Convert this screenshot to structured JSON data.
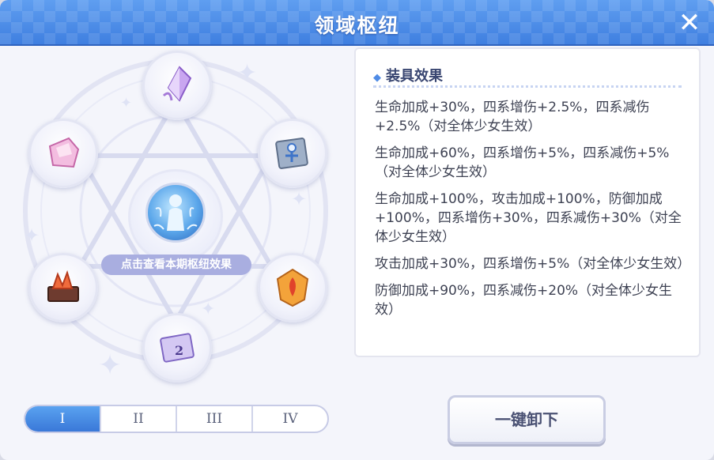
{
  "window": {
    "title": "领域枢纽",
    "close_icon": "close-icon"
  },
  "sigil": {
    "center_label": "点击查看本期枢纽效果",
    "center_icon": "domain-hub-icon",
    "slots": [
      {
        "icon": "crystal-shard-icon"
      },
      {
        "icon": "pink-crystal-icon"
      },
      {
        "icon": "blueprint-icon"
      },
      {
        "icon": "flame-box-icon"
      },
      {
        "icon": "fire-emblem-icon"
      },
      {
        "icon": "card-2-icon",
        "label": "2"
      }
    ]
  },
  "tabs": {
    "active_index": 0,
    "items": [
      "I",
      "II",
      "III",
      "IV"
    ]
  },
  "panel": {
    "heading": "装具效果",
    "effects": [
      "生命加成+30%，四系增伤+2.5%，四系减伤+2.5%（对全体少女生效）",
      "生命加成+60%，四系增伤+5%，四系减伤+5%（对全体少女生效）",
      "生命加成+100%，攻击加成+100%，防御加成+100%，四系增伤+30%，四系减伤+30%（对全体少女生效）",
      "攻击加成+30%，四系增伤+5%（对全体少女生效）",
      "防御加成+90%，四系减伤+20%（对全体少女生效）"
    ]
  },
  "actions": {
    "unequip_label": "一键卸下"
  },
  "colors": {
    "title_bar": "#3f7fe0",
    "tab_active": "#3a78d8",
    "center_label_bg": "#a9aee0",
    "panel_heading": "#3a4772"
  }
}
